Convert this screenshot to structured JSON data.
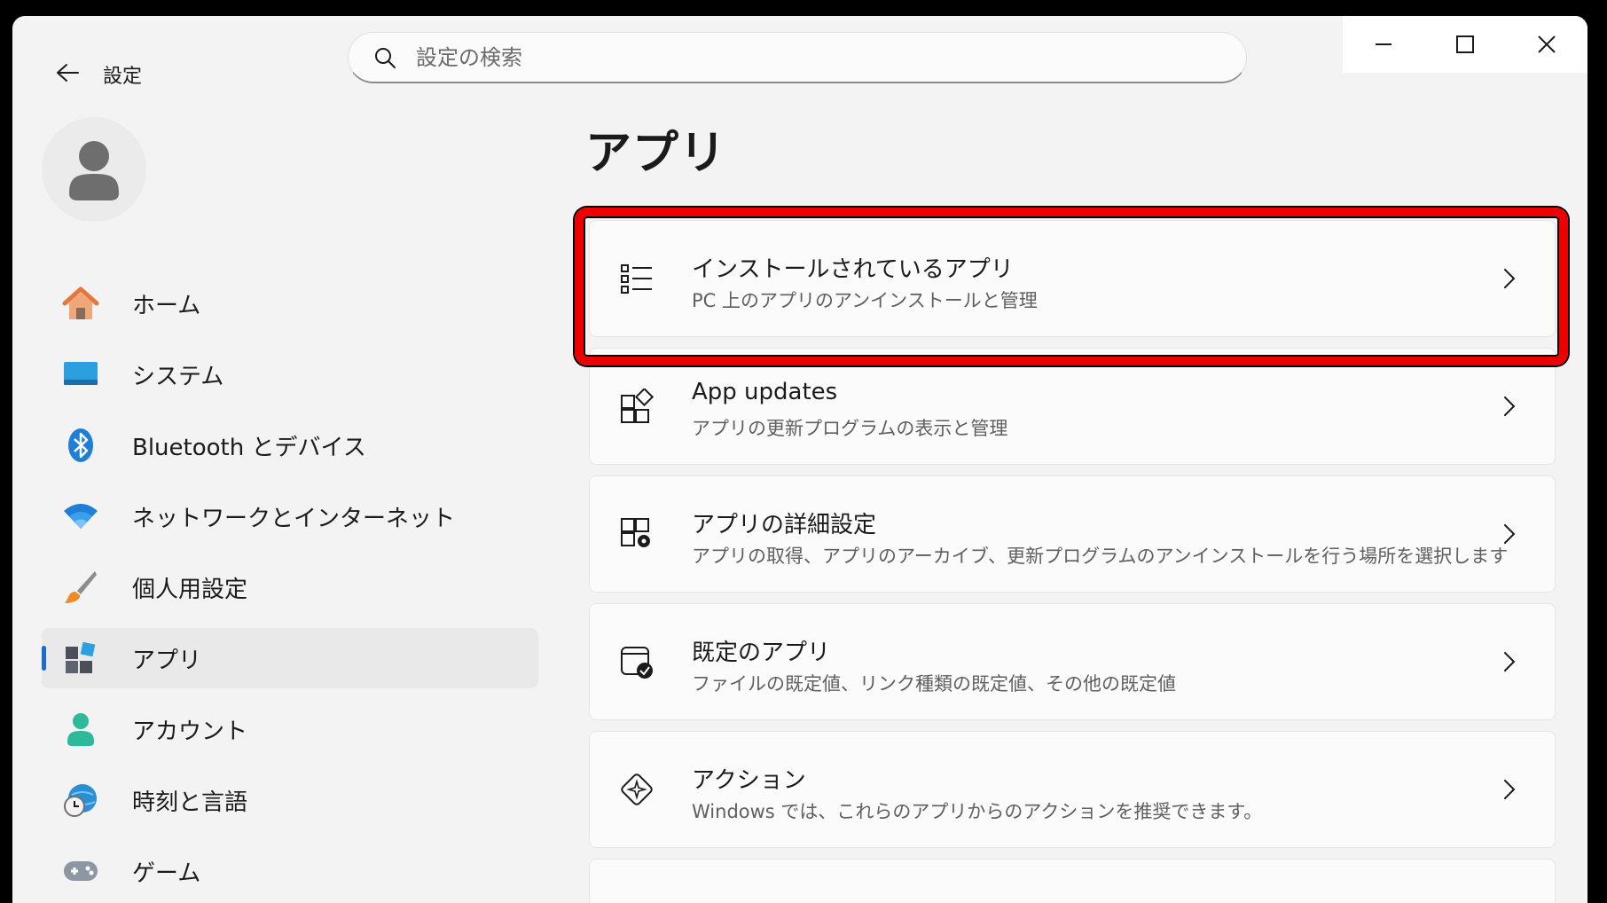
{
  "window": {
    "app_title": "設定",
    "search_placeholder": "設定の検索"
  },
  "sidebar": {
    "items": [
      {
        "label": "ホーム",
        "icon": "home-icon"
      },
      {
        "label": "システム",
        "icon": "system-icon"
      },
      {
        "label": "Bluetooth とデバイス",
        "icon": "bluetooth-icon"
      },
      {
        "label": "ネットワークとインターネット",
        "icon": "wifi-icon"
      },
      {
        "label": "個人用設定",
        "icon": "brush-icon"
      },
      {
        "label": "アプリ",
        "icon": "apps-icon",
        "active": true
      },
      {
        "label": "アカウント",
        "icon": "account-icon"
      },
      {
        "label": "時刻と言語",
        "icon": "time-language-icon"
      },
      {
        "label": "ゲーム",
        "icon": "gamepad-icon"
      }
    ]
  },
  "main": {
    "title": "アプリ",
    "cards": [
      {
        "title": "インストールされているアプリ",
        "subtitle": "PC 上のアプリのアンインストールと管理",
        "icon": "list-icon",
        "highlighted": true
      },
      {
        "title": "App updates",
        "subtitle": "アプリの更新プログラムの表示と管理",
        "icon": "app-updates-icon"
      },
      {
        "title": "アプリの詳細設定",
        "subtitle": "アプリの取得、アプリのアーカイブ、更新プログラムのアンインストールを行う場所を選択します",
        "icon": "advanced-apps-icon"
      },
      {
        "title": "既定のアプリ",
        "subtitle": "ファイルの既定値、リンク種類の既定値、その他の既定値",
        "icon": "default-apps-icon"
      },
      {
        "title": "アクション",
        "subtitle": "Windows では、これらのアプリからのアクションを推奨できます。",
        "icon": "actions-icon"
      }
    ]
  },
  "colors": {
    "accent": "#1a6ad1",
    "highlight_border": "#ee0000",
    "background": "#f3f3f3"
  }
}
